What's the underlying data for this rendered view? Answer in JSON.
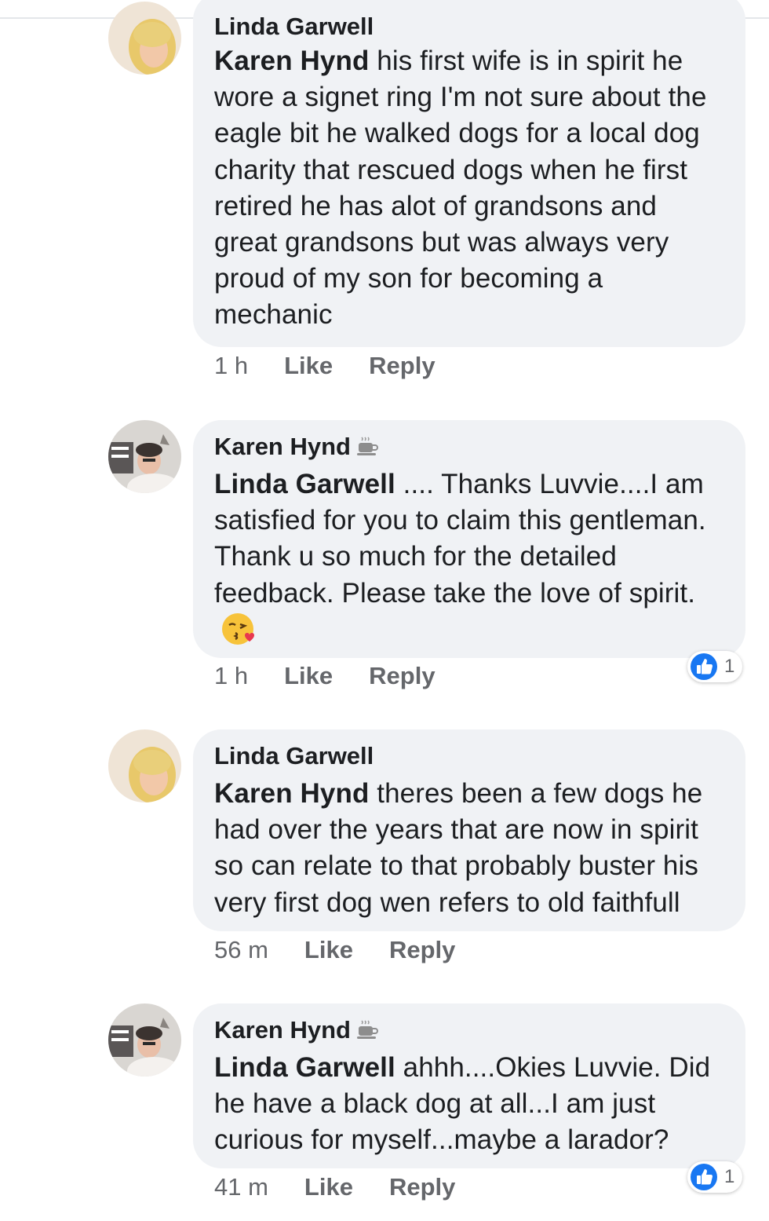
{
  "comments": [
    {
      "author": "Linda Garwell",
      "mention": "Karen Hynd",
      "text": " his first wife is in spirit he wore a signet ring I'm not sure about the eagle bit he walked dogs for a local dog charity that rescued dogs when he first retired he has alot of grandsons and great grandsons but was always very proud of my son for becoming a mechanic",
      "time": "1 h",
      "like": "Like",
      "reply": "Reply"
    },
    {
      "author": "Karen Hynd",
      "mention": "Linda Garwell",
      "text": " .... Thanks Luvvie....I am satisfied for you to claim this gentleman. Thank u so much for the detailed feedback. Please take the love of spirit.",
      "time": "1 h",
      "like": "Like",
      "reply": "Reply",
      "reaction_count": "1"
    },
    {
      "author": "Linda Garwell",
      "mention": "Karen Hynd",
      "text": " theres been a few dogs he had over the years that are now in spirit so can relate to that probably buster his very first dog wen refers to old faithfull",
      "time": "56 m",
      "like": "Like",
      "reply": "Reply"
    },
    {
      "author": "Karen Hynd",
      "mention": "Linda Garwell",
      "text": " ahhh....Okies Luvvie. Did he have a black dog at all...I am just curious for myself...maybe a larador?",
      "time": "41 m",
      "like": "Like",
      "reply": "Reply",
      "reaction_count": "1"
    }
  ],
  "icons": {
    "author_badge": "coffee-cup-icon",
    "emoji": "kissing-face-icon",
    "reaction": "like-thumb-icon"
  },
  "colors": {
    "bubble": "#f0f2f5",
    "text": "#1c1e21",
    "meta": "#65676b",
    "like_blue": "#1877f2"
  }
}
